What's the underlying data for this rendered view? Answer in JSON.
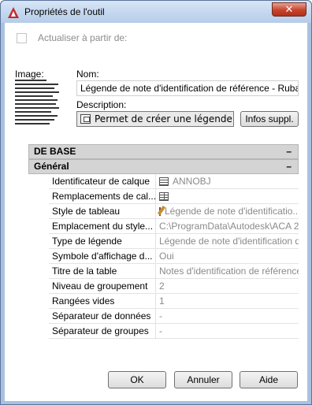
{
  "window": {
    "title": "Propriétés de l'outil",
    "close_label": "✕"
  },
  "update_checkbox": {
    "label": "Actualiser à partir de:",
    "checked": false
  },
  "image_label": "Image:",
  "name_label": "Nom:",
  "name_value": "Légende de note d'identification de référence - Ruban",
  "description_label": "Description:",
  "description_value": "Permet de créer une légende de r",
  "info_button": "Infos suppl.",
  "sections": {
    "base": {
      "title": "DE BASE",
      "toggle": "–"
    },
    "general": {
      "title": "Général",
      "toggle": "–"
    }
  },
  "properties": [
    {
      "key": "Identificateur de calque",
      "value": "ANNOBJ",
      "icon": "layer-icon"
    },
    {
      "key": "Remplacements  de cal...",
      "value": "",
      "icon": "table-icon"
    },
    {
      "key": "Style de tableau",
      "value": "Légende de note d'identificatio...",
      "icon": "table-style-icon"
    },
    {
      "key": "Emplacement  du style...",
      "value": "C:\\ProgramData\\Autodesk\\ACA 20..."
    },
    {
      "key": "Type de légende",
      "value": "Légende de note d'identification de..."
    },
    {
      "key": "Symbole d'affichage d...",
      "value": "Oui"
    },
    {
      "key": "Titre de la table",
      "value": "Notes d'identification de référence"
    },
    {
      "key": "Niveau de groupement",
      "value": "2"
    },
    {
      "key": "Rangées vides",
      "value": "1"
    },
    {
      "key": "Séparateur de données",
      "value": "-"
    },
    {
      "key": "Séparateur de groupes",
      "value": "-"
    }
  ],
  "footer": {
    "ok": "OK",
    "cancel": "Annuler",
    "help": "Aide"
  },
  "colors": {
    "frame": "#a9c1e0",
    "close_button": "#c7432c",
    "section_header": "#d4d4d4"
  }
}
